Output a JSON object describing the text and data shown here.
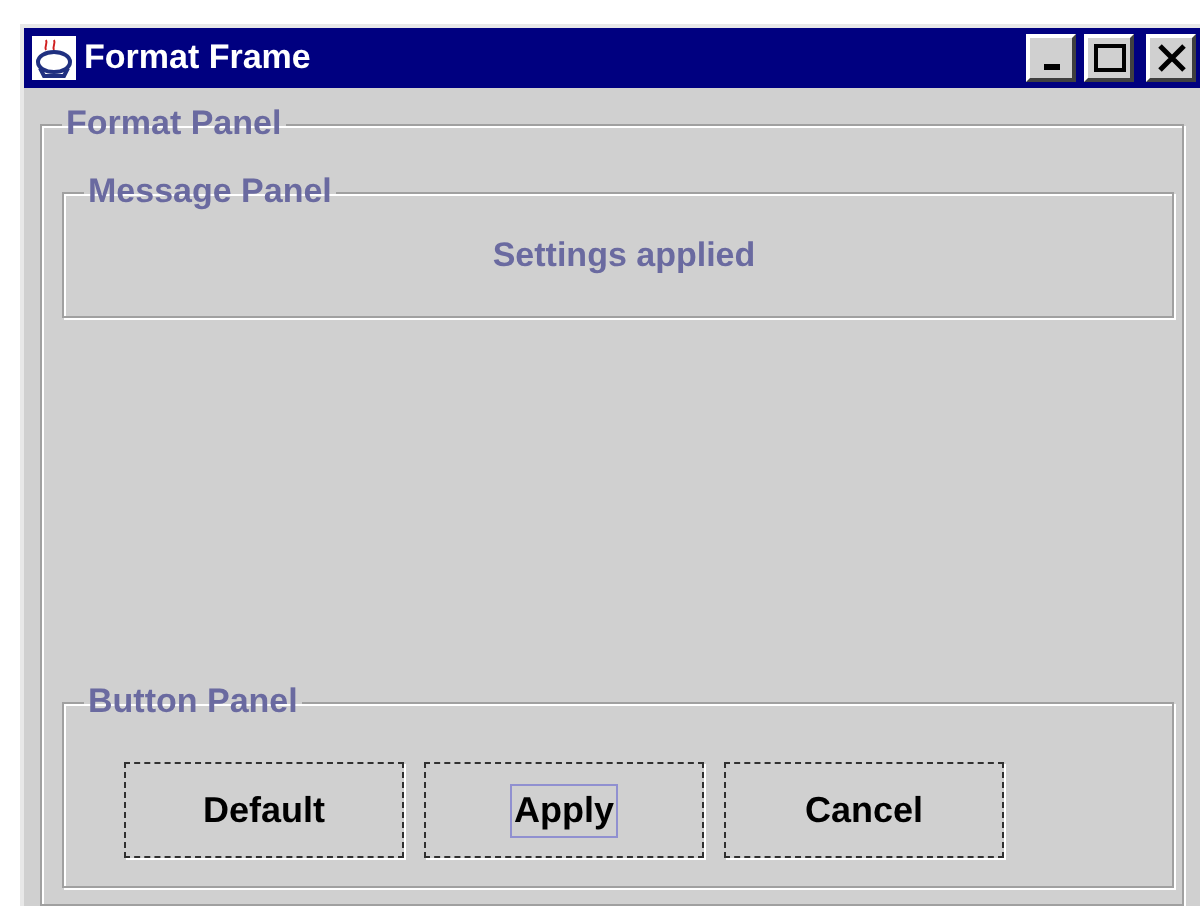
{
  "window": {
    "title": "Format Frame"
  },
  "format_panel": {
    "title": "Format Panel",
    "message_panel": {
      "title": "Message Panel",
      "message": "Settings applied"
    },
    "button_panel": {
      "title": "Button Panel",
      "buttons": [
        {
          "label": "Default",
          "focused": false
        },
        {
          "label": "Apply",
          "focused": true
        },
        {
          "label": "Cancel",
          "focused": false
        }
      ]
    }
  }
}
